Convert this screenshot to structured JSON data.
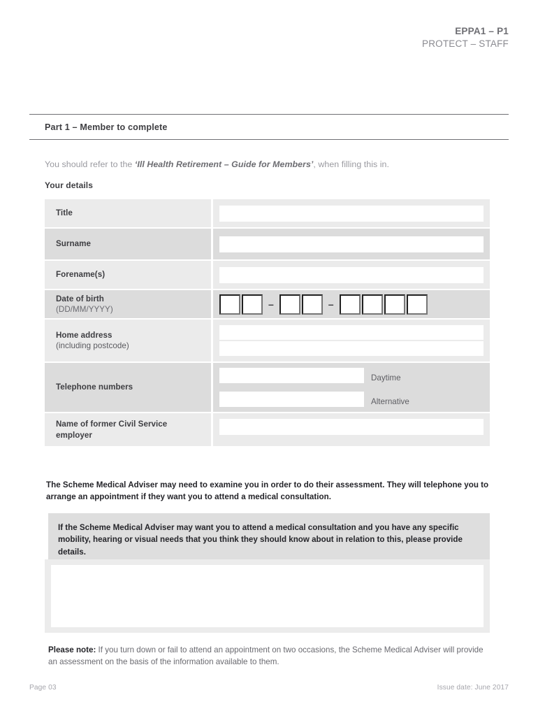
{
  "header": {
    "code": "EPPA1 – P1",
    "classification": "PROTECT – STAFF"
  },
  "part_banner": {
    "title": "Part 1 – Member to complete"
  },
  "intro": {
    "before": "You should refer to the ",
    "guide_title": "‘Ill Health Retirement – Guide for Members’",
    "after": ", when filling this in.",
    "section_label": "Your details"
  },
  "form": {
    "rows": [
      {
        "label": "Title",
        "type": "text"
      },
      {
        "label": "Surname",
        "type": "text"
      },
      {
        "label": "Forename(s)",
        "type": "text"
      },
      {
        "label": "Date of birth ",
        "label_paren": "(DD/MM/YYYY)",
        "type": "date",
        "separator": "–"
      },
      {
        "label": "Home address",
        "sub": "(including postcode)",
        "type": "text2"
      },
      {
        "label": "Telephone numbers",
        "type": "tel",
        "tel_labels": [
          "Daytime",
          "Alternative"
        ]
      },
      {
        "label": "Name of former Civil Service employer",
        "type": "text"
      }
    ]
  },
  "body": {
    "paragraph": "The Scheme Medical Adviser may need to examine you in order to do their assessment. They will telephone you to arrange an appointment if they want you to attend a medical consultation.",
    "notice": "If the Scheme Medical Adviser may want you to attend a medical consultation and you have any specific mobility, hearing or visual needs that you think they should know about in relation to this, please provide details.",
    "answer_value": "",
    "please_note_lead": "Please note:",
    "please_note_text": " If you turn down or fail to attend an appointment on two occasions, the Scheme Medical Adviser will provide an assessment on the basis of the information available to them."
  },
  "footer": {
    "page": "Page 03",
    "issue_date": "Issue date: June 2017"
  }
}
